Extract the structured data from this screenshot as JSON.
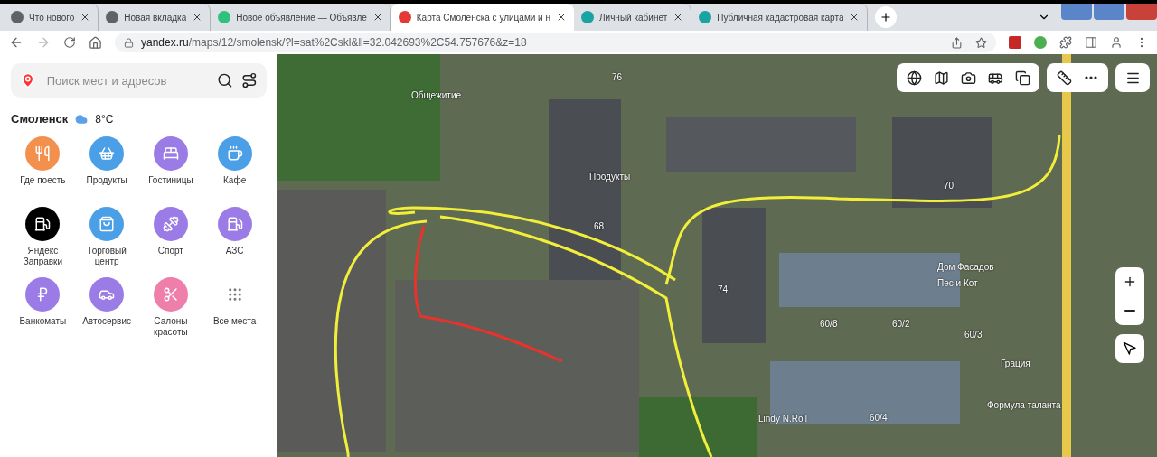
{
  "tabs": [
    {
      "title": "Что нового",
      "selected": false
    },
    {
      "title": "Новая вкладка",
      "selected": false
    },
    {
      "title": "Новое объявление — Объявле",
      "selected": false
    },
    {
      "title": "Карта Смоленска с улицами и н",
      "selected": true
    },
    {
      "title": "Личный кабинет",
      "selected": false
    },
    {
      "title": "Публичная кадастровая карта",
      "selected": false
    }
  ],
  "address_bar": {
    "host": "yandex.ru",
    "path": "/maps/12/smolensk/?l=sat%2Cskl&ll=32.042693%2C54.757676&z=18"
  },
  "sidebar": {
    "search": {
      "placeholder": "Поиск мест и адресов"
    },
    "city": "Смоленск",
    "temperature": "8°C",
    "categories": [
      {
        "label": "Где поесть",
        "color": "#f3904e"
      },
      {
        "label": "Продукты",
        "color": "#4b9fe6"
      },
      {
        "label": "Гостиницы",
        "color": "#9b7be6"
      },
      {
        "label": "Кафе",
        "color": "#4b9fe6"
      },
      {
        "label": "Яндекс Заправки",
        "color": "#000000"
      },
      {
        "label": "Торговый центр",
        "color": "#4b9fe6"
      },
      {
        "label": "Спорт",
        "color": "#9b7be6"
      },
      {
        "label": "АЗС",
        "color": "#9b7be6"
      },
      {
        "label": "Банкоматы",
        "color": "#9b7be6"
      },
      {
        "label": "Автосервис",
        "color": "#9b7be6"
      },
      {
        "label": "Салоны красоты",
        "color": "#ee7eaa"
      },
      {
        "label": "Все места",
        "color": "#ffffff"
      }
    ]
  },
  "map": {
    "labels": [
      {
        "text": "Общежитие"
      },
      {
        "text": "76"
      },
      {
        "text": "Продукты"
      },
      {
        "text": "68"
      },
      {
        "text": "70"
      },
      {
        "text": "74"
      },
      {
        "text": "Дом Фасадов"
      },
      {
        "text": "Пес и Кот"
      },
      {
        "text": "60/8"
      },
      {
        "text": "60/2"
      },
      {
        "text": "60/3"
      },
      {
        "text": "60/4"
      },
      {
        "text": "Грация"
      },
      {
        "text": "Формула таланта"
      },
      {
        "text": "Lindy N.Roll"
      }
    ]
  }
}
